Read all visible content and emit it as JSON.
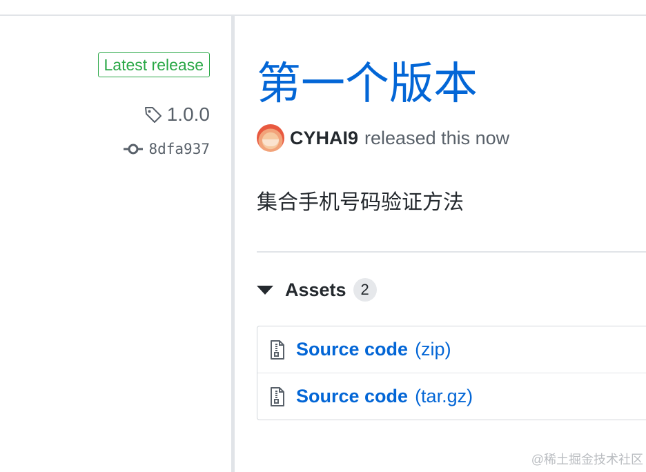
{
  "meta": {
    "latest_badge": "Latest release",
    "tag": "1.0.0",
    "commit": "8dfa937"
  },
  "release": {
    "title": "第一个版本",
    "author": "CYHAI9",
    "released_text": "released this now",
    "body": "集合手机号码验证方法"
  },
  "assets": {
    "label": "Assets",
    "count": "2",
    "items": [
      {
        "name": "Source code",
        "ext": "(zip)"
      },
      {
        "name": "Source code",
        "ext": "(tar.gz)"
      }
    ]
  },
  "watermark": "@稀土掘金技术社区",
  "colors": {
    "link": "#0366d6",
    "badge_green": "#28a745",
    "muted": "#586069"
  }
}
